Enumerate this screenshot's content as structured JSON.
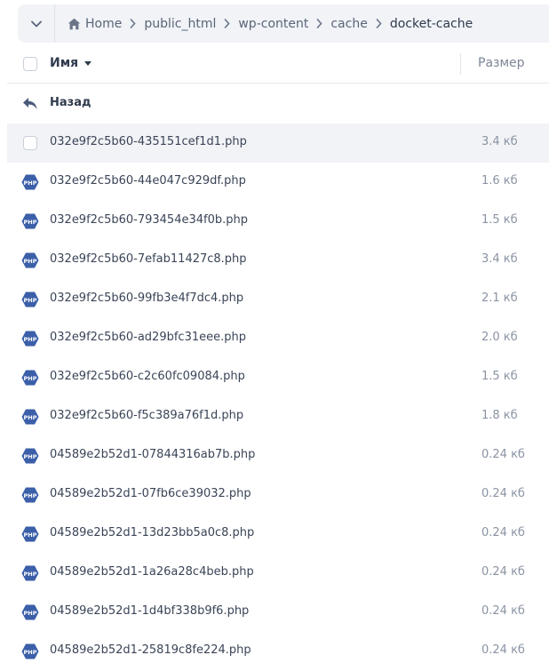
{
  "breadcrumb": {
    "items": [
      "Home",
      "public_html",
      "wp-content",
      "cache",
      "docket-cache"
    ]
  },
  "table": {
    "name_header": "Имя",
    "size_header": "Размер",
    "back_label": "Назад",
    "rows": [
      {
        "name": "032e9f2c5b60-435151cef1d1.php",
        "size": "3.4 кб"
      },
      {
        "name": "032e9f2c5b60-44e047c929df.php",
        "size": "1.6 кб"
      },
      {
        "name": "032e9f2c5b60-793454e34f0b.php",
        "size": "1.5 кб"
      },
      {
        "name": "032e9f2c5b60-7efab11427c8.php",
        "size": "3.4 кб"
      },
      {
        "name": "032e9f2c5b60-99fb3e4f7dc4.php",
        "size": "2.1 кб"
      },
      {
        "name": "032e9f2c5b60-ad29bfc31eee.php",
        "size": "2.0 кб"
      },
      {
        "name": "032e9f2c5b60-c2c60fc09084.php",
        "size": "1.5 кб"
      },
      {
        "name": "032e9f2c5b60-f5c389a76f1d.php",
        "size": "1.8 кб"
      },
      {
        "name": "04589e2b52d1-07844316ab7b.php",
        "size": "0.24 кб"
      },
      {
        "name": "04589e2b52d1-07fb6ce39032.php",
        "size": "0.24 кб"
      },
      {
        "name": "04589e2b52d1-13d23bb5a0c8.php",
        "size": "0.24 кб"
      },
      {
        "name": "04589e2b52d1-1a26a28c4beb.php",
        "size": "0.24 кб"
      },
      {
        "name": "04589e2b52d1-1d4bf338b9f6.php",
        "size": "0.24 кб"
      },
      {
        "name": "04589e2b52d1-25819c8fe224.php",
        "size": "0.24 кб"
      }
    ]
  },
  "colors": {
    "php_badge": "#3b5fa8",
    "hover_row": "#f2f3f6",
    "breadcrumb_bg": "#f1f3f7"
  }
}
